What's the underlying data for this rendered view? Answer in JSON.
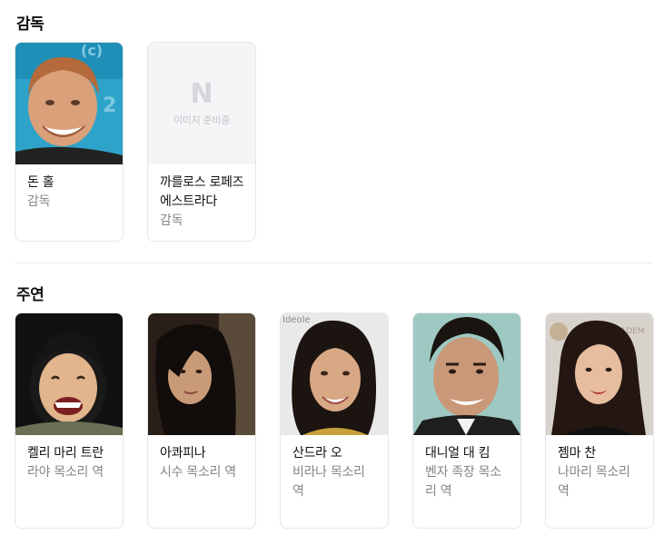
{
  "directors": {
    "title": "감독",
    "people": [
      {
        "name": "돈 홀",
        "role": "감독",
        "image": "photo"
      },
      {
        "name": "까를로스 로페즈 에스트라다",
        "role": "감독",
        "image": "placeholder"
      }
    ],
    "placeholder": {
      "logo": "N",
      "text": "이미지 준비중"
    }
  },
  "cast": {
    "title": "주연",
    "people": [
      {
        "name": "켈리 마리 트란",
        "role": "라야 목소리 역"
      },
      {
        "name": "아콰피나",
        "role": "시수 목소리 역"
      },
      {
        "name": "산드라 오",
        "role": "비라나 목소리 역"
      },
      {
        "name": "대니얼 대 킴",
        "role": "벤자 족장 목소리 역"
      },
      {
        "name": "젬마 찬",
        "role": "나마리 목소리 역"
      }
    ]
  }
}
